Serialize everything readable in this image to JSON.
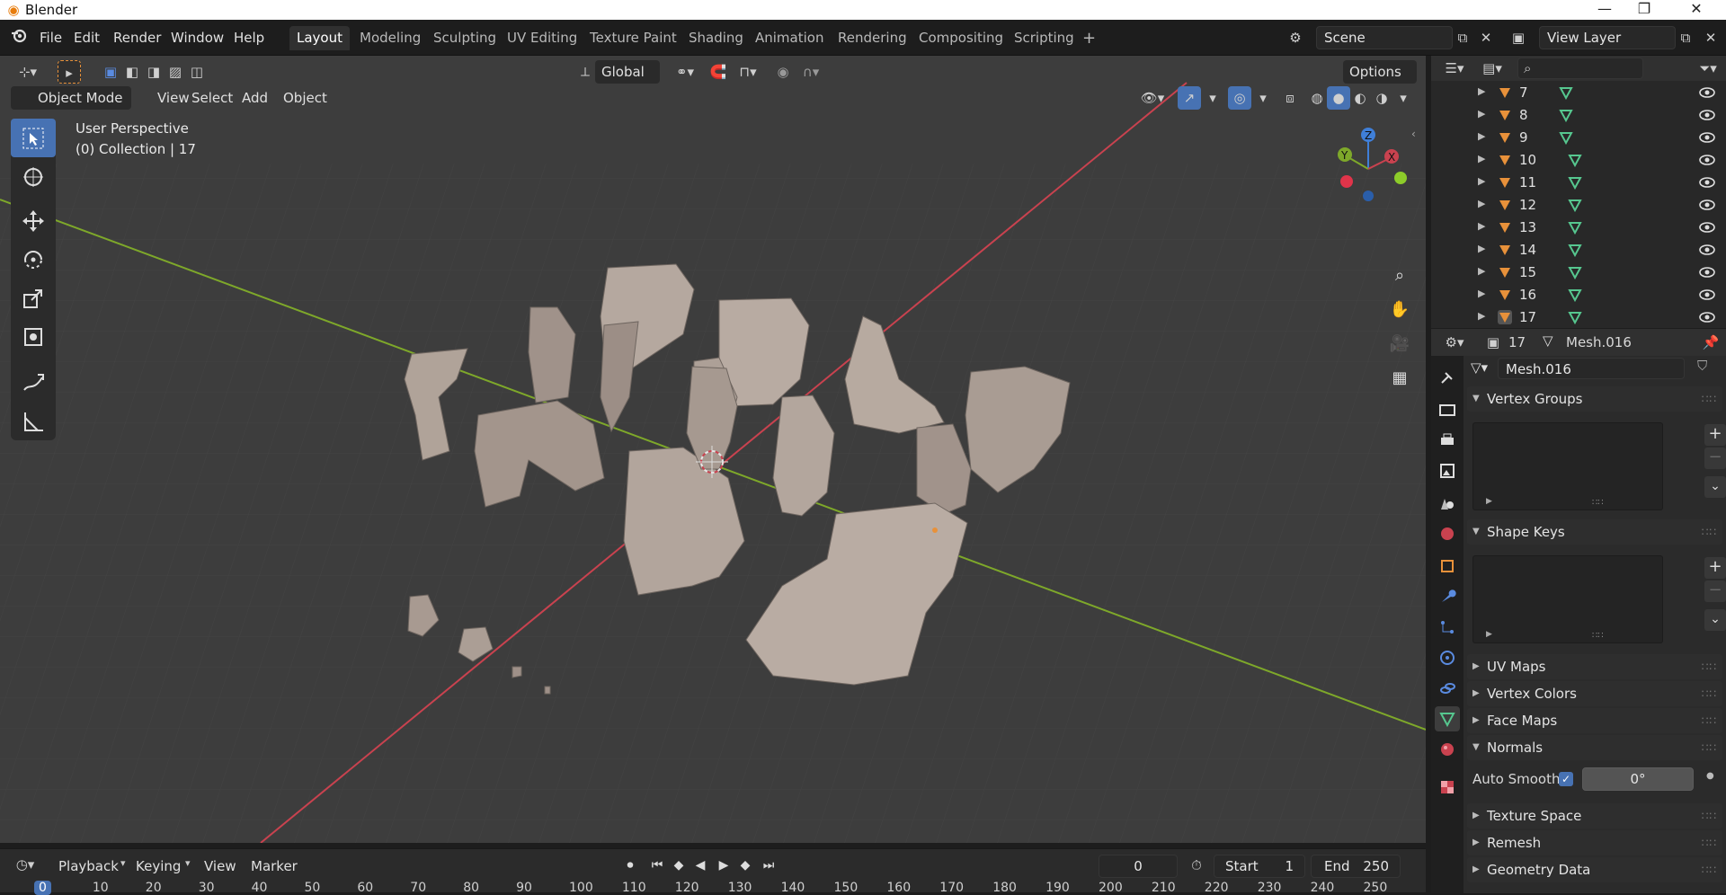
{
  "window": {
    "title": "Blender",
    "min_label": "—",
    "max_label": "❐",
    "close_label": "✕"
  },
  "menus": [
    "File",
    "Edit",
    "Render",
    "Window",
    "Help"
  ],
  "workspaces": [
    "Layout",
    "Modeling",
    "Sculpting",
    "UV Editing",
    "Texture Paint",
    "Shading",
    "Animation",
    "Rendering",
    "Compositing",
    "Scripting"
  ],
  "active_workspace": "Layout",
  "add_workspace": "+",
  "scene": {
    "name": "Scene",
    "view_layer": "View Layer"
  },
  "tool_header": {
    "orientation": "Global",
    "options": "Options"
  },
  "viewport_header": {
    "mode": "Object Mode",
    "menus": [
      "View",
      "Select",
      "Add",
      "Object"
    ]
  },
  "viewport_info": {
    "perspective": "User Perspective",
    "collection": "(0) Collection | 17"
  },
  "gizmo": {
    "z": "Z",
    "y": "Y",
    "x": "X"
  },
  "outliner": {
    "search_placeholder": "",
    "rows": [
      "7",
      "8",
      "9",
      "10",
      "11",
      "12",
      "13",
      "14",
      "15",
      "16",
      "17"
    ]
  },
  "properties": {
    "object_name": "17",
    "mesh_name": "Mesh.016",
    "mesh_field": "Mesh.016",
    "panels": {
      "vertex_groups": "Vertex Groups",
      "shape_keys": "Shape Keys",
      "uv_maps": "UV Maps",
      "vertex_colors": "Vertex Colors",
      "face_maps": "Face Maps",
      "normals": "Normals",
      "texture_space": "Texture Space",
      "remesh": "Remesh",
      "geometry_data": "Geometry Data"
    },
    "auto_smooth_label": "Auto Smooth",
    "auto_smooth_checked": true,
    "auto_smooth_angle": "0°"
  },
  "timeline": {
    "menus": [
      "Playback",
      "Keying",
      "View",
      "Marker"
    ],
    "current_frame": "0",
    "start_label": "Start",
    "start": "1",
    "end_label": "End",
    "end": "250",
    "ruler": [
      "0",
      "10",
      "20",
      "30",
      "40",
      "50",
      "60",
      "70",
      "80",
      "90",
      "100",
      "110",
      "120",
      "130",
      "140",
      "150",
      "160",
      "170",
      "180",
      "190",
      "200",
      "210",
      "220",
      "230",
      "240",
      "250"
    ]
  },
  "colors": {
    "accent": "#4772b3",
    "mesh_orange": "#e8913a",
    "data_green": "#56c78f",
    "x_axis": "#c9424f",
    "y_axis": "#7ea82a"
  }
}
